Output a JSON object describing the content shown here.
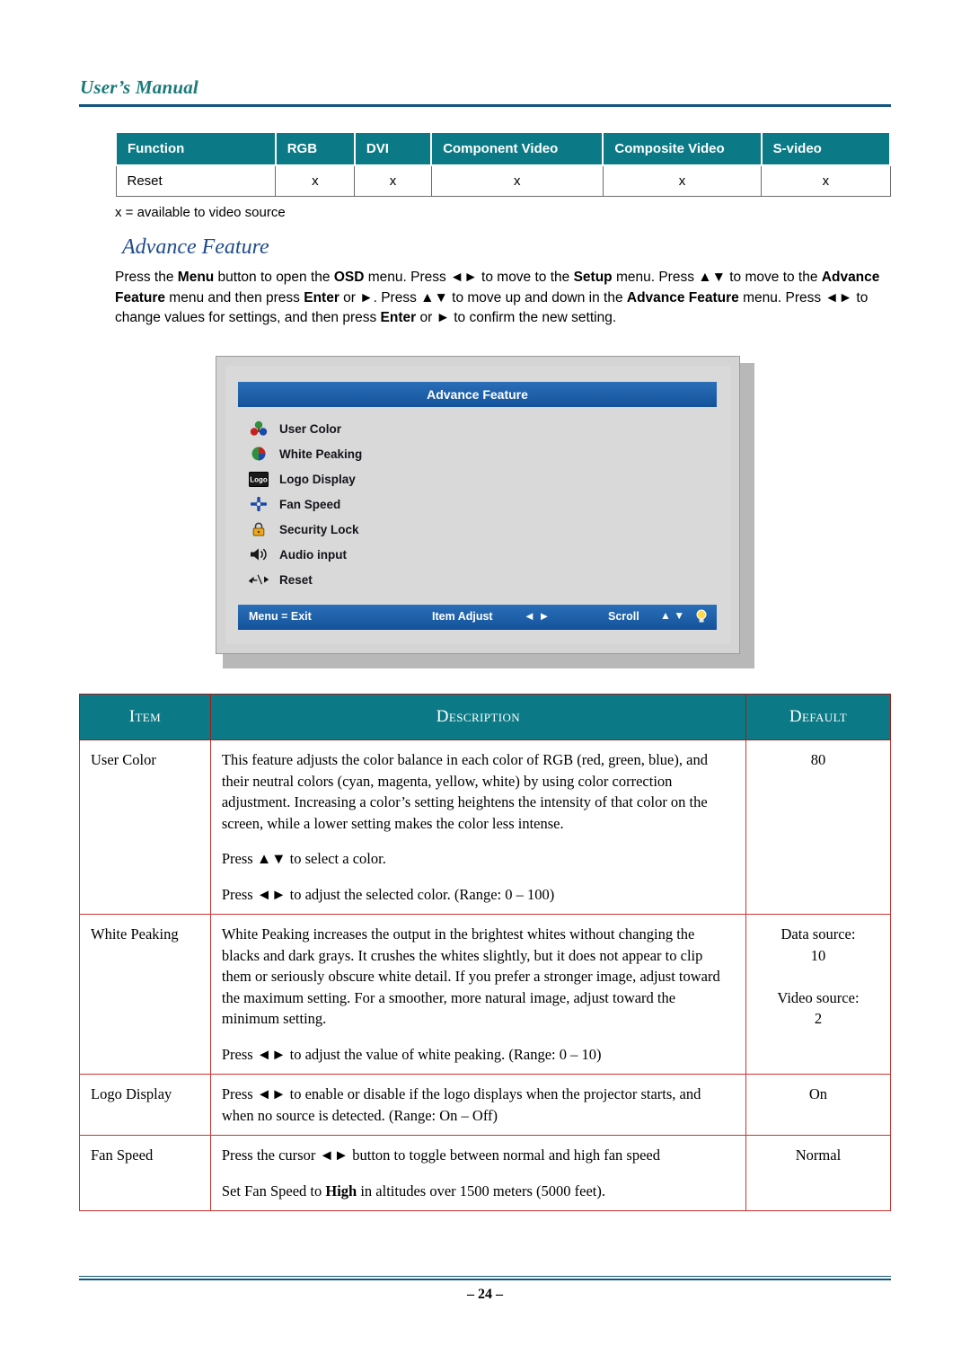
{
  "header": {
    "title": "User’s Manual"
  },
  "compat_table": {
    "headers": [
      "Function",
      "RGB",
      "DVI",
      "Component Video",
      "Composite Video",
      "S-video"
    ],
    "rows": [
      {
        "function": "Reset",
        "rgb": "x",
        "dvi": "x",
        "component": "x",
        "composite": "x",
        "svideo": "x"
      }
    ],
    "legend": "x = available to video source"
  },
  "section": {
    "title": "Advance Feature",
    "intro_html": "Press the <b>Menu</b> button to open the <b>OSD</b> menu. Press ◄► to move to the <b>Setup</b> menu. Press ▲▼ to move to the <b>Advance Feature</b> menu and then press <b>Enter</b> or ►. Press ▲▼ to move up and down in the <b>Advance Feature</b> menu. Press ◄► to change values for settings, and then press <b>Enter</b> or ► to confirm the new setting."
  },
  "osd": {
    "title": "Advance Feature",
    "items": [
      {
        "label": "User Color",
        "icon": "user-color-icon"
      },
      {
        "label": "White Peaking",
        "icon": "white-peaking-icon"
      },
      {
        "label": "Logo Display",
        "icon": "logo-display-icon"
      },
      {
        "label": "Fan Speed",
        "icon": "fan-speed-icon"
      },
      {
        "label": "Security Lock",
        "icon": "security-lock-icon"
      },
      {
        "label": "Audio input",
        "icon": "audio-input-icon"
      },
      {
        "label": "Reset",
        "icon": "reset-icon"
      }
    ],
    "footer": {
      "menu_exit": "Menu = Exit",
      "item_adjust": "Item Adjust",
      "item_adjust_arrows": "◄ ►",
      "scroll": "Scroll",
      "scroll_arrows": "▲ ▼",
      "bulb_icon": "bulb-icon"
    }
  },
  "main_table": {
    "headers": [
      "Item",
      "Description",
      "Default"
    ],
    "rows": [
      {
        "item": "User Color",
        "paragraphs": [
          "This feature adjusts the color balance in each color of RGB (red, green, blue), and their neutral colors (cyan, magenta, yellow, white) by using color correction adjustment. Increasing a color’s setting heightens the intensity of that color on the screen, while a lower setting makes the color less intense.",
          "Press ▲▼ to select a color.",
          "Press ◄► to adjust the selected color. (Range: 0 – 100)"
        ],
        "default": "80"
      },
      {
        "item": "White Peaking",
        "paragraphs": [
          "White Peaking increases the output in the brightest whites without changing the blacks and dark grays. It crushes the whites slightly, but it does not appear to clip them or seriously obscure white detail. If you prefer a stronger image, adjust toward the maximum setting. For a smoother, more natural image, adjust toward the minimum setting.",
          "Press ◄► to adjust the value of white peaking. (Range: 0 – 10)"
        ],
        "default": "Data source:\n10\n\nVideo source:\n2"
      },
      {
        "item": "Logo Display",
        "paragraphs": [
          "Press ◄► to enable or disable if the logo displays when the projector starts, and when no source is detected. (Range: On – Off)"
        ],
        "default": "On"
      },
      {
        "item": "Fan Speed",
        "paragraphs": [
          "Press the cursor ◄► button to toggle between normal and high fan speed",
          "Set Fan Speed to High in altitudes over 1500 meters (5000 feet)."
        ],
        "default": "Normal"
      }
    ]
  },
  "footer": {
    "page": "– 24 –"
  }
}
